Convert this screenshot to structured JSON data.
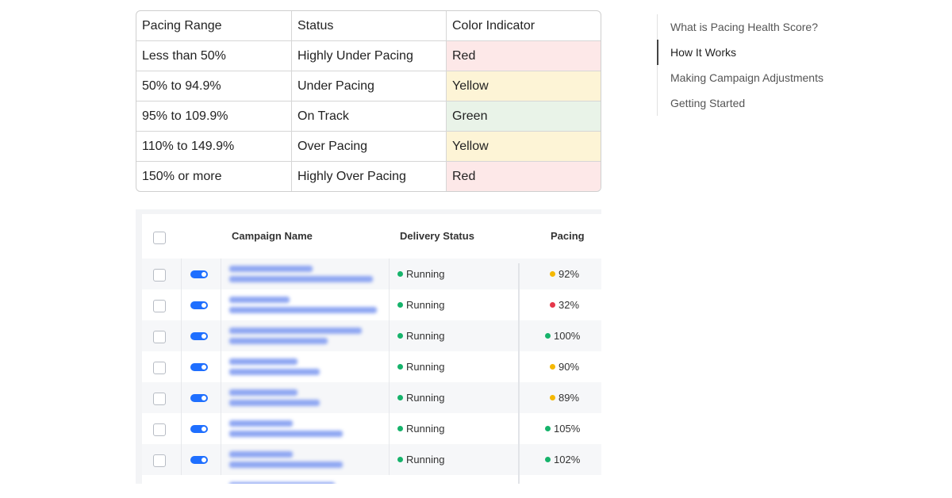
{
  "reference_table": {
    "headers": [
      "Pacing Range",
      "Status",
      "Color Indicator"
    ],
    "rows": [
      {
        "range": "Less than 50%",
        "status": "Highly Under Pacing",
        "color_label": "Red"
      },
      {
        "range": "50% to 94.9%",
        "status": "Under Pacing",
        "color_label": "Yellow"
      },
      {
        "range": "95% to 109.9%",
        "status": "On Track",
        "color_label": "Green"
      },
      {
        "range": "110% to 149.9%",
        "status": "Over Pacing",
        "color_label": "Yellow"
      },
      {
        "range": "150% or more",
        "status": "Highly Over Pacing",
        "color_label": "Red"
      }
    ],
    "colors": {
      "red": "#fde8e8",
      "yellow": "#fdf4d6",
      "green": "#e9f3e8"
    }
  },
  "toc": {
    "items": [
      {
        "label": "What is Pacing Health Score?",
        "active": false
      },
      {
        "label": "How It Works",
        "active": true
      },
      {
        "label": "Making Campaign Adjustments",
        "active": false
      },
      {
        "label": "Getting Started",
        "active": false
      }
    ]
  },
  "campaign_table": {
    "headers": {
      "name": "Campaign Name",
      "delivery": "Delivery Status",
      "pacing": "Pacing"
    },
    "rows": [
      {
        "status": "Running",
        "pacing": "92%",
        "pacing_color": "#f5b800"
      },
      {
        "status": "Running",
        "pacing": "32%",
        "pacing_color": "#e5374a"
      },
      {
        "status": "Running",
        "pacing": "100%",
        "pacing_color": "#16b36b"
      },
      {
        "status": "Running",
        "pacing": "90%",
        "pacing_color": "#f5b800"
      },
      {
        "status": "Running",
        "pacing": "89%",
        "pacing_color": "#f5b800"
      },
      {
        "status": "Running",
        "pacing": "105%",
        "pacing_color": "#16b36b"
      },
      {
        "status": "Running",
        "pacing": "102%",
        "pacing_color": "#16b36b"
      }
    ],
    "status_color": "#16b36b",
    "toggle_color": "#1f6fff"
  }
}
